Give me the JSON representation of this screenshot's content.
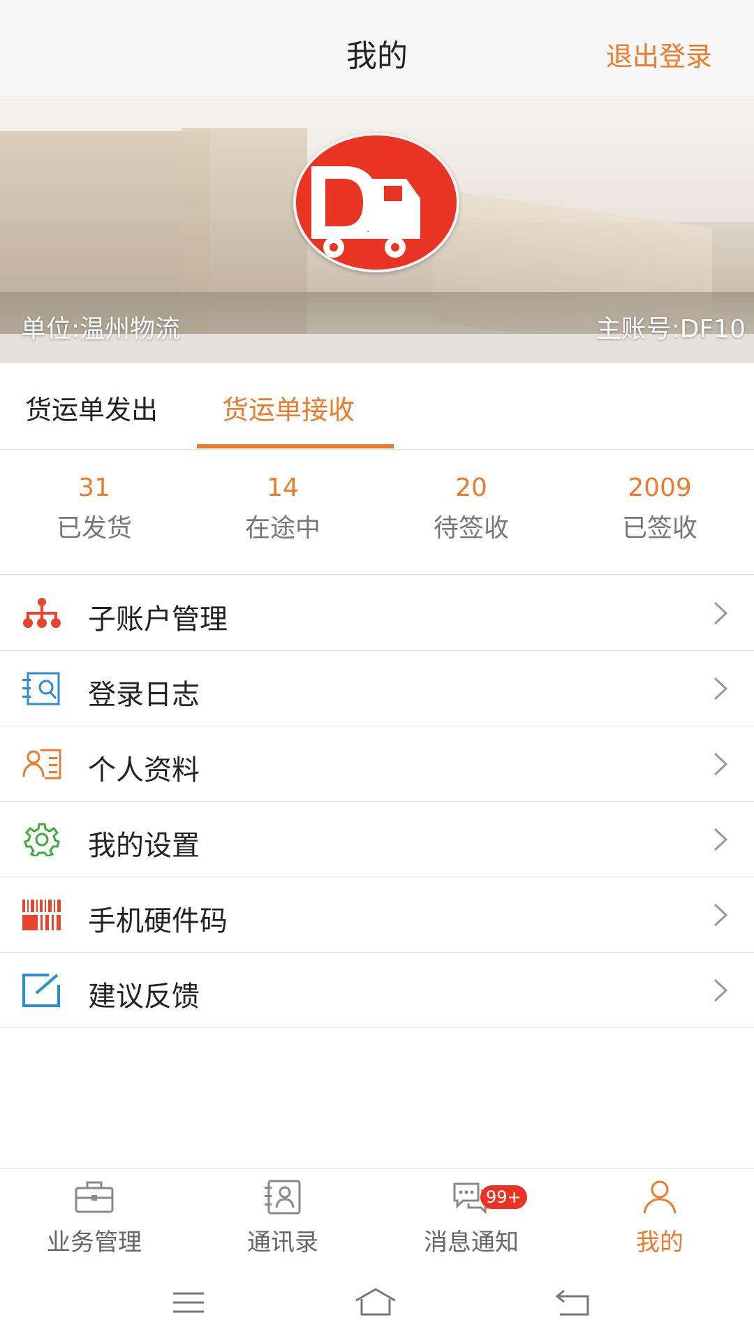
{
  "header": {
    "title": "我的",
    "logout_label": "退出登录"
  },
  "banner": {
    "unit_text": "单位:温州物流",
    "account_text": "主账号:DF10"
  },
  "tabs": [
    {
      "label": "货运单发出",
      "active": false
    },
    {
      "label": "货运单接收",
      "active": true
    }
  ],
  "stats": [
    {
      "value": "31",
      "label": "已发货"
    },
    {
      "value": "14",
      "label": "在途中"
    },
    {
      "value": "20",
      "label": "待签收"
    },
    {
      "value": "2009",
      "label": "已签收"
    }
  ],
  "menu": [
    {
      "label": "子账户管理",
      "icon": "org-chart-icon",
      "color": "#e8452c"
    },
    {
      "label": "登录日志",
      "icon": "log-search-icon",
      "color": "#2a8fcf"
    },
    {
      "label": "个人资料",
      "icon": "profile-card-icon",
      "color": "#ec7c2c"
    },
    {
      "label": "我的设置",
      "icon": "gear-icon",
      "color": "#3cae3a"
    },
    {
      "label": "手机硬件码",
      "icon": "barcode-icon",
      "color": "#e8452c"
    },
    {
      "label": "建议反馈",
      "icon": "edit-feedback-icon",
      "color": "#2a8fcf"
    }
  ],
  "bottom_nav": [
    {
      "label": "业务管理",
      "icon": "briefcase-icon",
      "active": false
    },
    {
      "label": "通讯录",
      "icon": "contacts-icon",
      "active": false
    },
    {
      "label": "消息通知",
      "icon": "chat-icon",
      "active": false,
      "badge": "99+"
    },
    {
      "label": "我的",
      "icon": "user-icon",
      "active": true
    }
  ],
  "colors": {
    "accent": "#ec7c2c",
    "badge": "#e93323"
  }
}
